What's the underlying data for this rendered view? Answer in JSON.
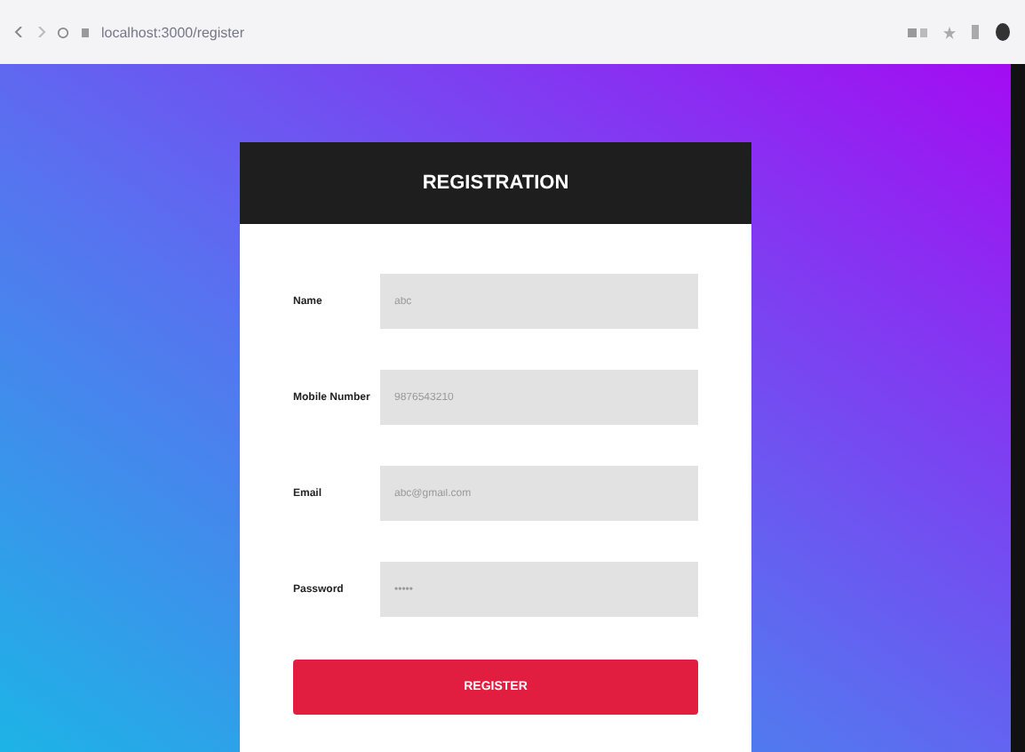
{
  "browser": {
    "url": "localhost:3000/register"
  },
  "form": {
    "title": "REGISTRATION",
    "fields": [
      {
        "label": "Name",
        "value": "abc"
      },
      {
        "label": "Mobile Number",
        "value": "9876543210"
      },
      {
        "label": "Email",
        "value": "abc@gmail.com"
      },
      {
        "label": "Password",
        "value": "•••••"
      }
    ],
    "submit": "REGISTER"
  }
}
